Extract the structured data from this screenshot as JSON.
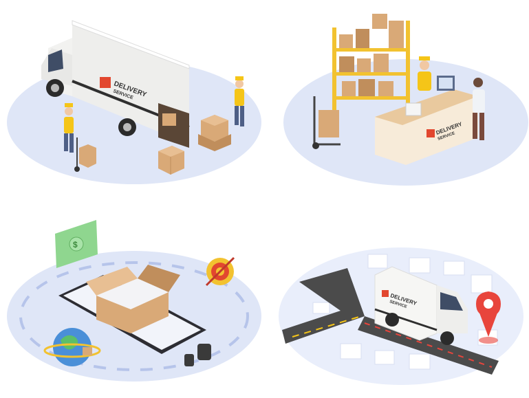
{
  "colors": {
    "background": "#ffffff",
    "platform": "#dfe6f7",
    "platform_shadow": "#c9d3ee",
    "box": "#d9a977",
    "box_dark": "#c08e5c",
    "worker_shirt": "#f5c518",
    "shelf": "#f2c230",
    "logo_red": "#e2472f",
    "van_body": "#f6f6f4",
    "road": "#4b4b4b",
    "road_dash": "#f5c518",
    "pin": "#e8453c",
    "money": "#8fd68f"
  },
  "scenes": {
    "loading": {
      "van_logo": [
        "DELIVERY",
        "SERVICE"
      ]
    },
    "warehouse": {
      "counter_logo": [
        "DELIVERY",
        "SERVICE"
      ]
    },
    "online_order": {
      "icons": [
        "banknote-icon",
        "globe-icon",
        "weights-icon",
        "target-icon"
      ]
    },
    "tracking": {
      "van_logo": [
        "DELIVERY",
        "SERVICE"
      ],
      "icons": [
        "location-pin-icon"
      ]
    }
  }
}
